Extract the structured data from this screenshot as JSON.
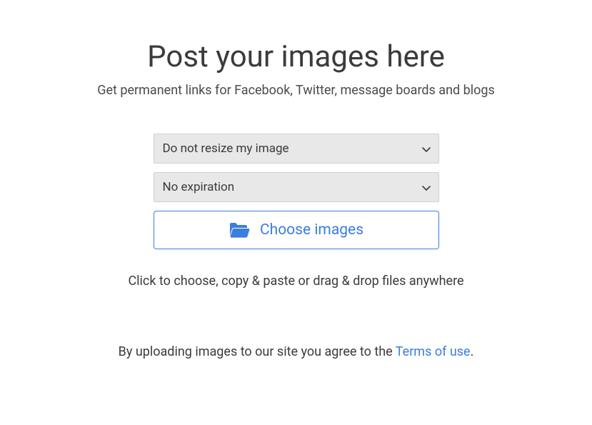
{
  "title": "Post your images here",
  "subtitle": "Get permanent links for Facebook, Twitter, message boards and blogs",
  "resize_select": {
    "selected": "Do not resize my image"
  },
  "expiration_select": {
    "selected": "No expiration"
  },
  "choose_button": {
    "label": "Choose images"
  },
  "hint": "Click to choose, copy & paste or drag & drop files anywhere",
  "terms": {
    "prefix": "By uploading images to our site you agree to the ",
    "link_label": "Terms of use",
    "suffix": "."
  }
}
